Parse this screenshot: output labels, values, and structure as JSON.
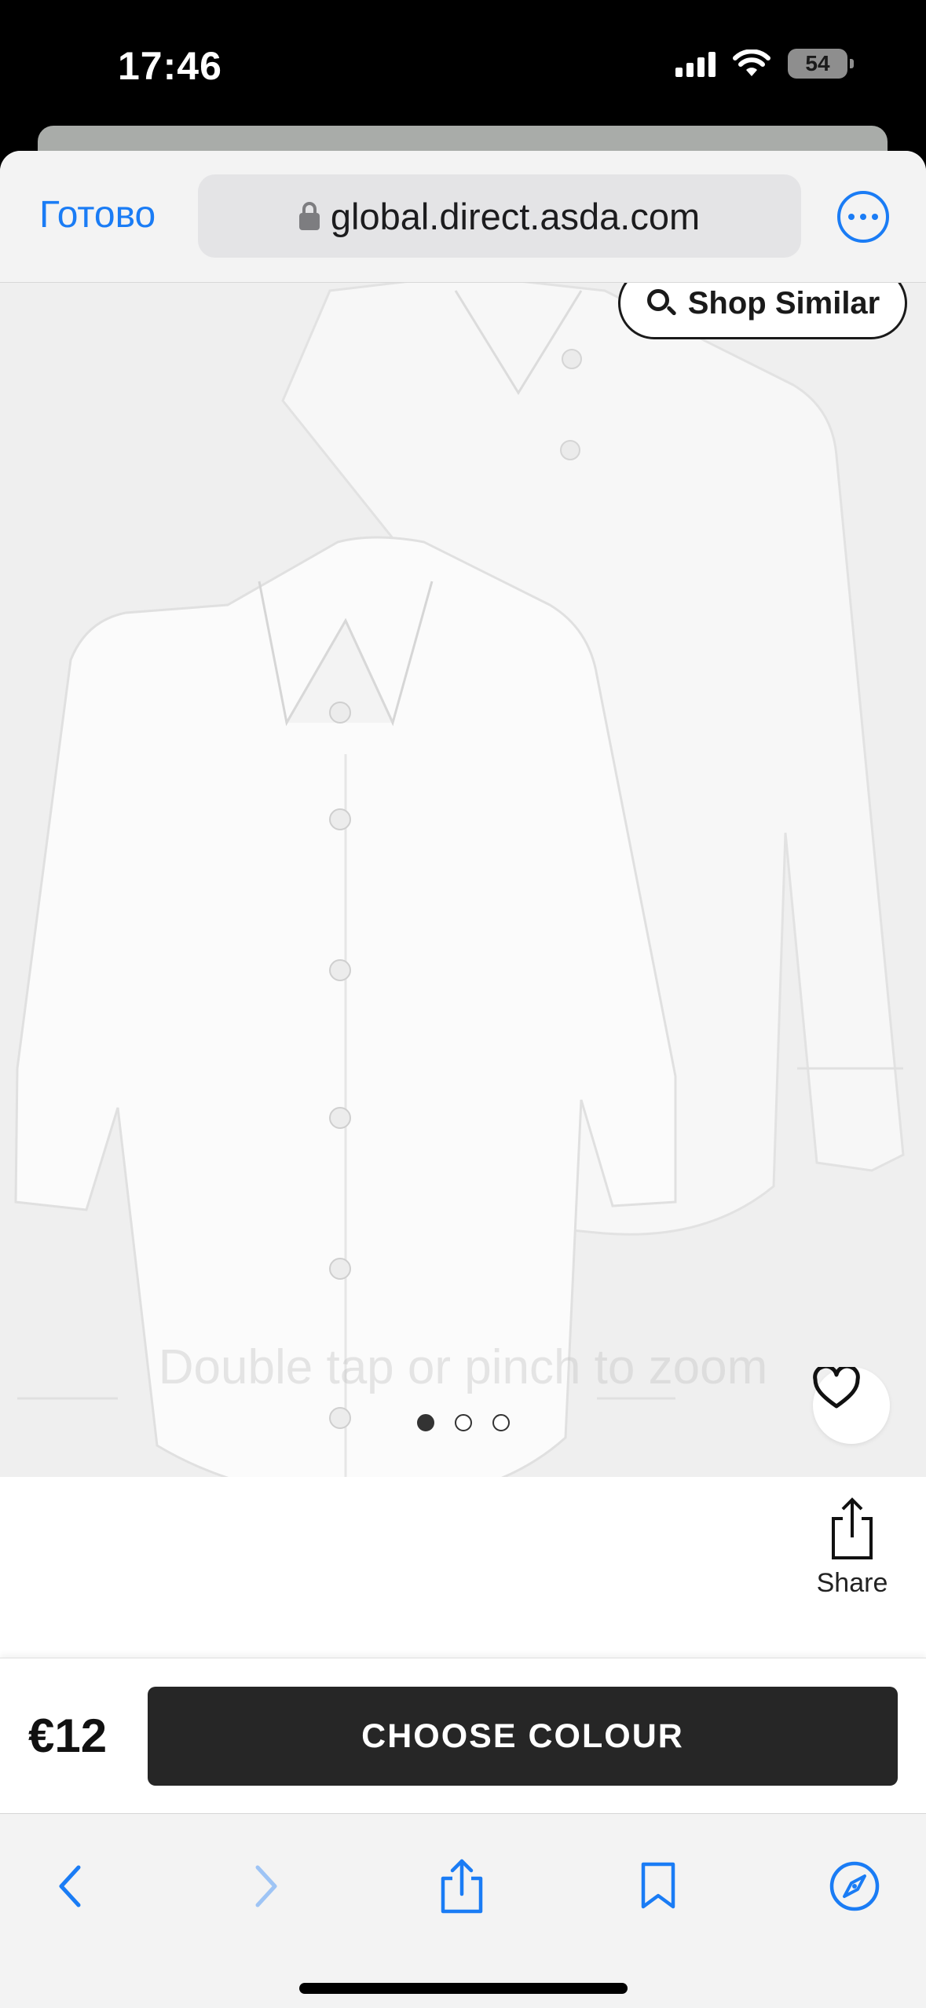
{
  "status_bar": {
    "time": "17:46",
    "battery": "54"
  },
  "browser": {
    "done_label": "Готово",
    "url": "global.direct.asda.com"
  },
  "product": {
    "shop_similar_label": "Shop Similar",
    "zoom_hint": "Double tap or pinch to zoom",
    "image_count": 3,
    "active_image": 1,
    "share_label": "Share",
    "price": "€12",
    "choose_button_label": "CHOOSE COLOUR"
  },
  "icons": {
    "status": [
      "signal-icon",
      "wifi-icon",
      "battery-icon"
    ],
    "nav": [
      "lock-icon",
      "more-icon"
    ],
    "product": [
      "search-icon",
      "heart-icon",
      "share-icon"
    ],
    "toolbar": [
      "back-icon",
      "forward-icon",
      "share-icon",
      "bookmarks-icon",
      "compass-icon"
    ]
  },
  "colors": {
    "accent": "#1a7cf5",
    "button": "#262626"
  }
}
